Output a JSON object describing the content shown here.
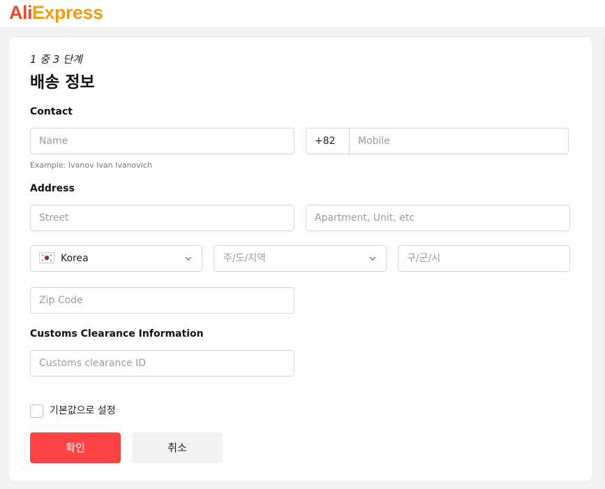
{
  "header": {
    "logo_part1": "Ali",
    "logo_part2": "Express"
  },
  "form": {
    "step": "1 중 3 단계",
    "title": "배송 정보",
    "contact": {
      "heading": "Contact",
      "name_placeholder": "Name",
      "name_hint": "Example: Ivanov Ivan Ivanovich",
      "phone_code": "+82",
      "mobile_placeholder": "Mobile"
    },
    "address": {
      "heading": "Address",
      "street_placeholder": "Street",
      "apartment_placeholder": "Apartment, Unit, etc",
      "country_value": "Korea",
      "country_flag_icon": "south-korea-flag-icon",
      "province_placeholder": "주/도/지역",
      "city_placeholder": "구/군/시",
      "zip_placeholder": "Zip Code"
    },
    "customs": {
      "heading": "Customs Clearance Information",
      "id_placeholder": "Customs clearance ID"
    },
    "default_checkbox_label": "기본값으로 설정",
    "confirm_label": "확인",
    "cancel_label": "취소"
  },
  "colors": {
    "primary_button": "#fe4445",
    "logo_red": "#e8492b",
    "logo_orange": "#f29b17"
  }
}
